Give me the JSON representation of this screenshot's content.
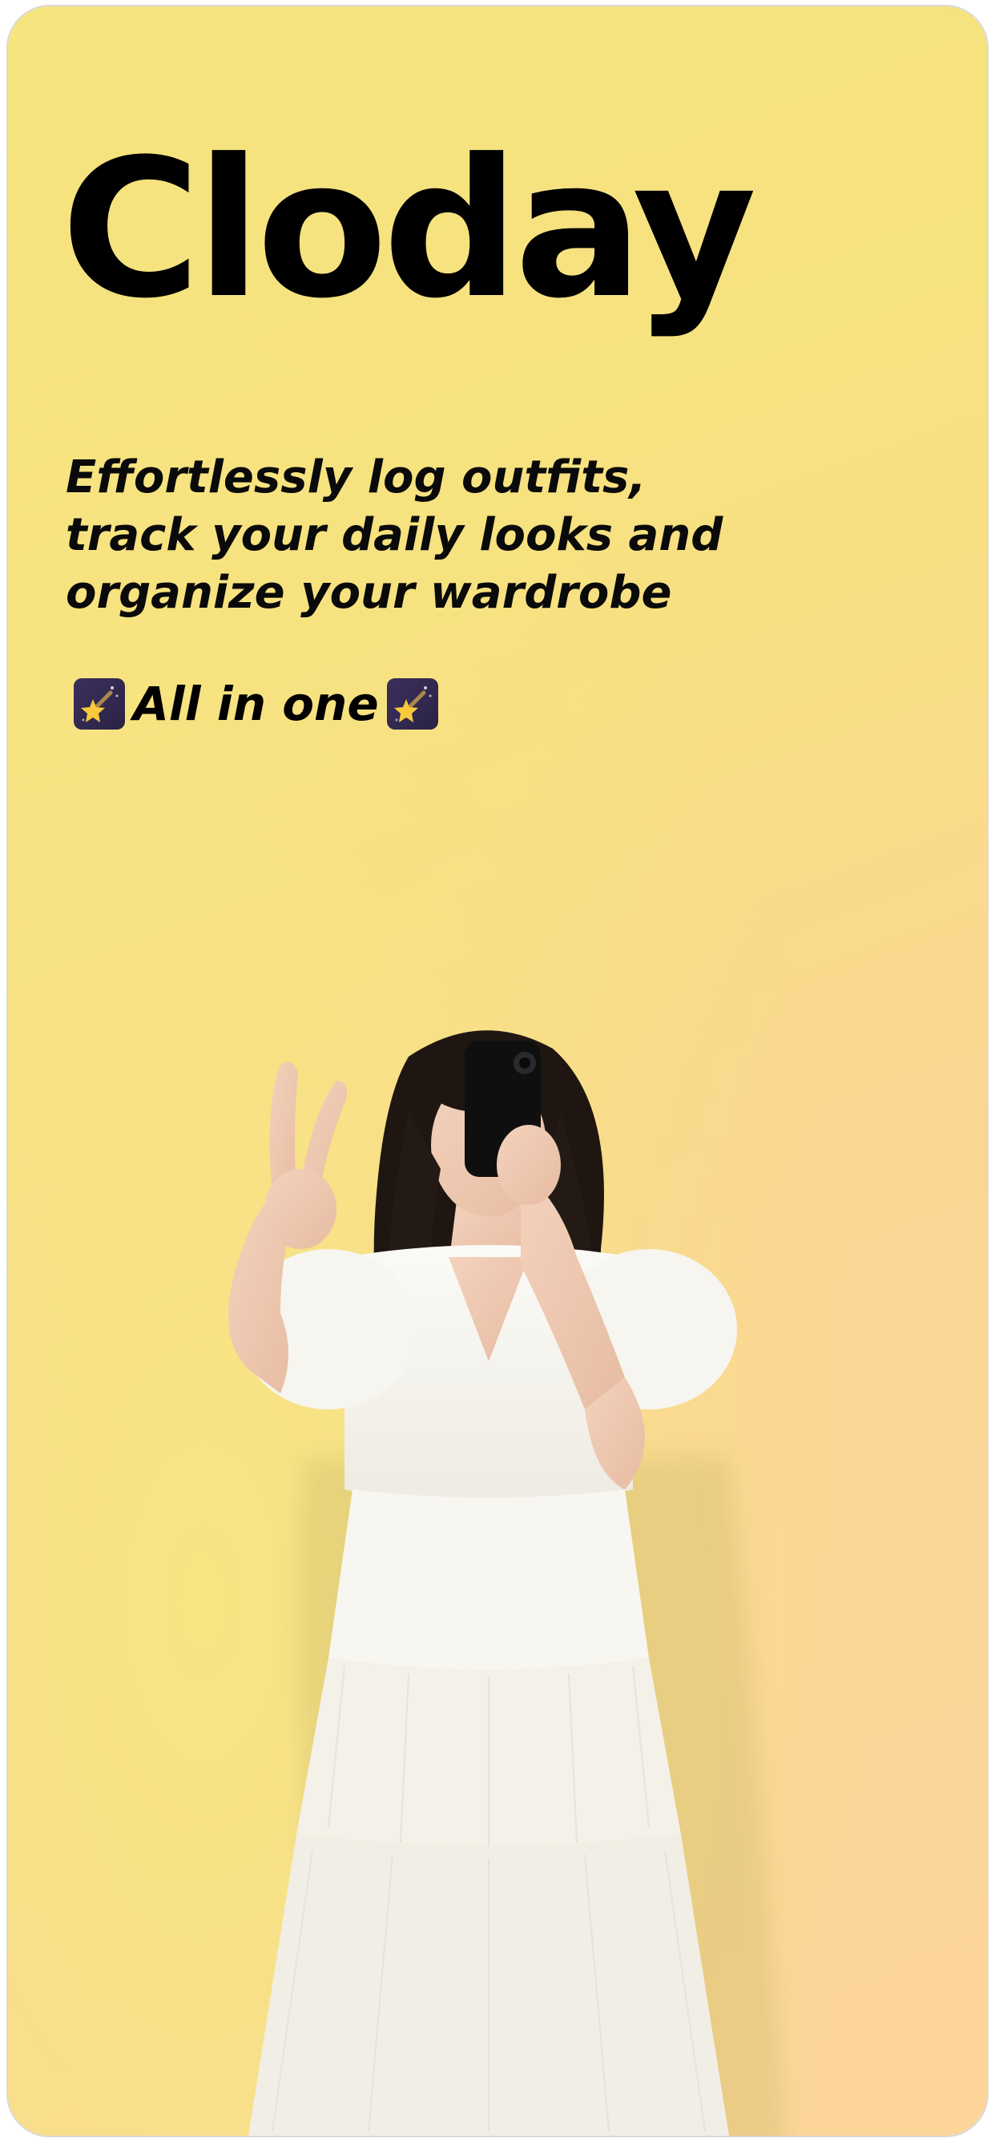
{
  "app": {
    "title": "Cloday",
    "tagline": "Effortlessly log outfits, track your daily looks and organize your wardrobe",
    "subtagline": "All in one"
  },
  "icons": {
    "leading": "shooting-star-icon",
    "trailing": "shooting-star-icon"
  },
  "colors": {
    "background_start": "#f6e47e",
    "background_end": "#fdd59b",
    "text": "#000000"
  }
}
